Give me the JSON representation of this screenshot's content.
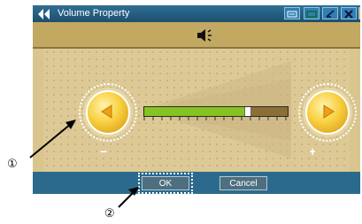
{
  "window": {
    "title": "Volume Property",
    "titlebar_buttons": [
      "keyboard-icon",
      "window-icon",
      "minimize-icon",
      "close-icon",
      "home-icon"
    ]
  },
  "volume": {
    "level_fraction": 0.72,
    "decrease_label": "−",
    "increase_label": "+"
  },
  "actions": {
    "ok_label": "OK",
    "cancel_label": "Cancel"
  },
  "callouts": {
    "one": "①",
    "two": "②"
  },
  "colors": {
    "accent_yellow": "#f8d040",
    "slider_fill": "#86c322",
    "titlebar": "#1d4f70"
  }
}
